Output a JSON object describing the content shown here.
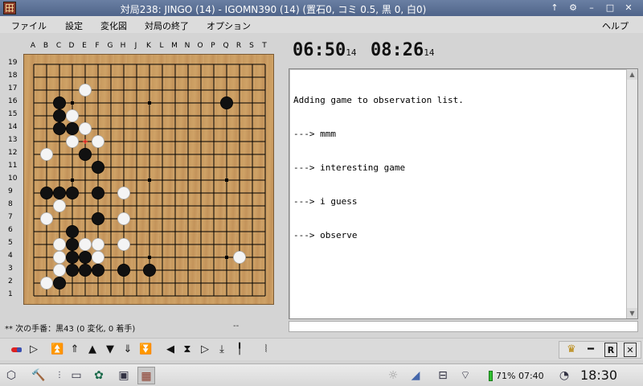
{
  "window": {
    "title": "対局238: JINGO (14) - IGOMN390 (14) (置石0, コミ 0.5, 黒 0, 白0)"
  },
  "menu": [
    "ファイル",
    "設定",
    "変化図",
    "対局の終了",
    "オプション",
    "ヘルプ"
  ],
  "board": {
    "columns": [
      "A",
      "B",
      "C",
      "D",
      "E",
      "F",
      "G",
      "H",
      "J",
      "K",
      "L",
      "M",
      "N",
      "O",
      "P",
      "Q",
      "R",
      "S",
      "T"
    ],
    "rows": [
      "19",
      "18",
      "17",
      "16",
      "15",
      "14",
      "13",
      "12",
      "11",
      "10",
      "9",
      "8",
      "7",
      "6",
      "5",
      "4",
      "3",
      "2",
      "1"
    ],
    "black": [
      "C16",
      "Q16",
      "C15",
      "C14",
      "D14",
      "E12",
      "F11",
      "B9",
      "C9",
      "D9",
      "F9",
      "F7",
      "D6",
      "D5",
      "D4",
      "E4",
      "D3",
      "E3",
      "F3",
      "H3",
      "K3",
      "C2"
    ],
    "white": [
      "E17",
      "D15",
      "E14",
      "D13",
      "F13",
      "B12",
      "H9",
      "C8",
      "B7",
      "H7",
      "C5",
      "E5",
      "F5",
      "H5",
      "C4",
      "F4",
      "R4",
      "C3",
      "B2"
    ],
    "last_move": "E13"
  },
  "timers": {
    "black": {
      "time": "06:50",
      "stones": "14"
    },
    "white": {
      "time": "08:26",
      "stones": "14"
    }
  },
  "chat": {
    "lines": [
      "Adding game to observation list.",
      "---> mmm",
      "---> interesting game",
      "---> i guess",
      "---> observe"
    ]
  },
  "status": {
    "text": "** 次の手番：黒43 (0 変化, 0 着手)",
    "extra": "--"
  },
  "taskbar": {
    "battery": "71% 07:40",
    "clock": "18:30"
  },
  "colors": {
    "titlebar": "#5a6f96",
    "board": "#c89a5f",
    "black_stone": "#111111",
    "white_stone": "#f4f4f4"
  }
}
